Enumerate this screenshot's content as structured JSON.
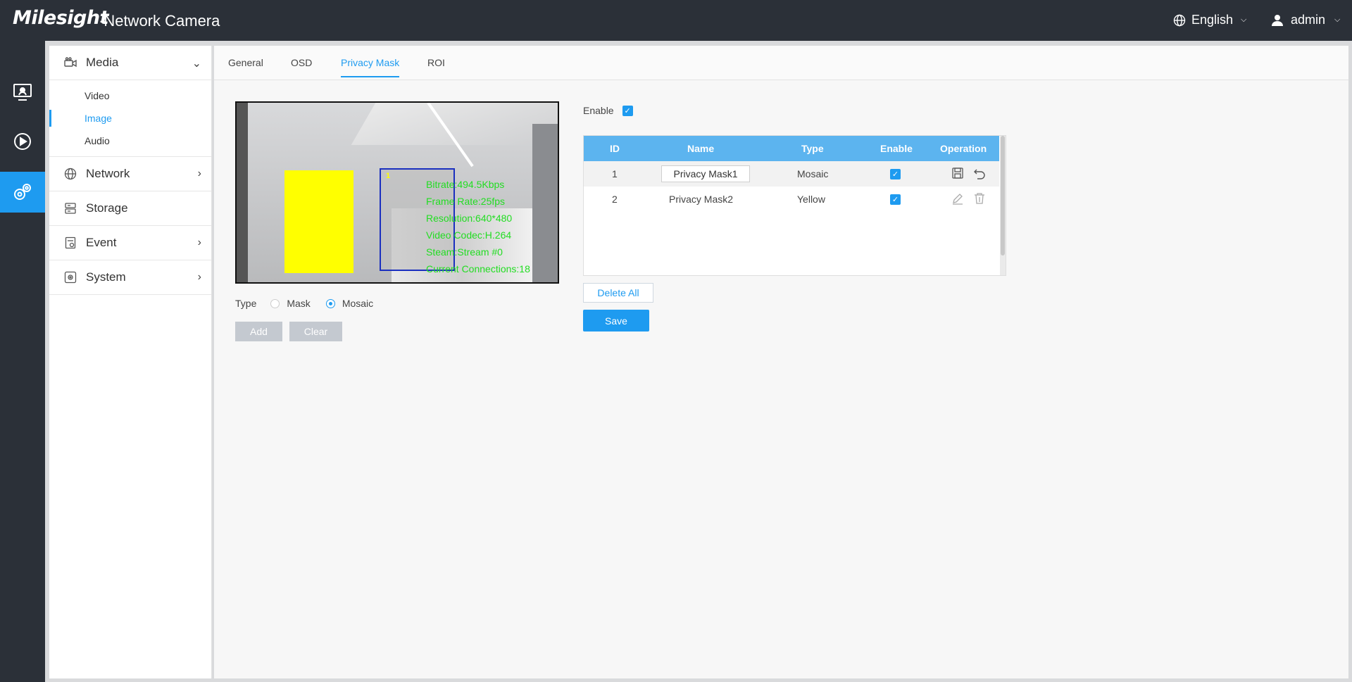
{
  "header": {
    "brand": "Milesight",
    "product": "·Network Camera",
    "language": "English",
    "user": "admin"
  },
  "rail": {
    "items": [
      {
        "name": "live-view-icon"
      },
      {
        "name": "playback-icon"
      },
      {
        "name": "settings-icon"
      }
    ]
  },
  "sidebar": {
    "media": "Media",
    "media_items": [
      "Video",
      "Image",
      "Audio"
    ],
    "network": "Network",
    "storage": "Storage",
    "event": "Event",
    "system": "System"
  },
  "tabs": [
    "General",
    "OSD",
    "Privacy Mask",
    "ROI"
  ],
  "preview": {
    "mask_id": "1",
    "osd_lines": [
      "Bitrate:494.5Kbps",
      "Frame Rate:25fps",
      "Resolution:640*480",
      "Video Codec:H.264",
      "Steam:Stream #0",
      "Current Connections:18"
    ]
  },
  "type_row": {
    "label": "Type",
    "option_mask": "Mask",
    "option_mosaic": "Mosaic",
    "selected": "Mosaic"
  },
  "buttons": {
    "add": "Add",
    "clear": "Clear",
    "delete_all": "Delete All",
    "save": "Save"
  },
  "enable_label": "Enable",
  "table": {
    "headers": [
      "ID",
      "Name",
      "Type",
      "Enable",
      "Operation"
    ],
    "rows": [
      {
        "id": "1",
        "name": "Privacy Mask1",
        "type": "Mosaic",
        "enabled": true
      },
      {
        "id": "2",
        "name": "Privacy Mask2",
        "type": "Yellow",
        "enabled": true
      }
    ]
  },
  "colors": {
    "accent": "#1e9bf0",
    "topbar": "#2b3038",
    "table_header": "#5cb4ef",
    "mask_yellow": "#ffff00",
    "osd_text": "#22dd22"
  }
}
